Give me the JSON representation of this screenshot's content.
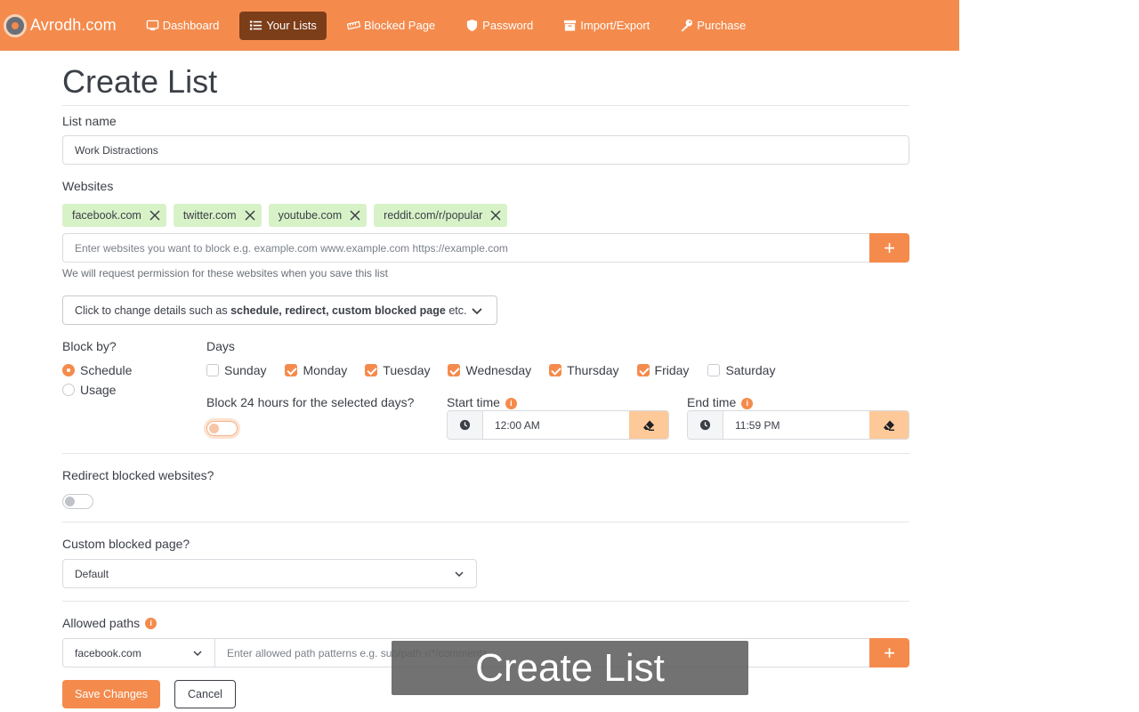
{
  "brand": {
    "name": "Avrodh.com"
  },
  "nav": [
    {
      "label": "Dashboard",
      "icon": "monitor-icon",
      "active": false
    },
    {
      "label": "Your Lists",
      "icon": "list-icon",
      "active": true
    },
    {
      "label": "Blocked Page",
      "icon": "ruler-icon",
      "active": false
    },
    {
      "label": "Password",
      "icon": "shield-icon",
      "active": false
    },
    {
      "label": "Import/Export",
      "icon": "archive-icon",
      "active": false
    },
    {
      "label": "Purchase",
      "icon": "key-icon",
      "active": false
    }
  ],
  "page": {
    "title": "Create List"
  },
  "list_name": {
    "label": "List name",
    "value": "Work Distractions"
  },
  "websites": {
    "label": "Websites",
    "tags": [
      "facebook.com",
      "twitter.com",
      "youtube.com",
      "reddit.com/r/popular"
    ],
    "placeholder": "Enter websites you want to block e.g. example.com www.example.com https://example.com",
    "add_label": "+",
    "help": "We will request permission for these websites when you save this list"
  },
  "details_toggle": {
    "prefix": "Click to change details such as ",
    "bold": "schedule, redirect, custom blocked page",
    "suffix": " etc."
  },
  "block_by": {
    "label": "Block by?",
    "options": [
      {
        "label": "Schedule",
        "checked": true
      },
      {
        "label": "Usage",
        "checked": false
      }
    ]
  },
  "days": {
    "label": "Days",
    "items": [
      {
        "label": "Sunday",
        "checked": false
      },
      {
        "label": "Monday",
        "checked": true
      },
      {
        "label": "Tuesday",
        "checked": true
      },
      {
        "label": "Wednesday",
        "checked": true
      },
      {
        "label": "Thursday",
        "checked": true
      },
      {
        "label": "Friday",
        "checked": true
      },
      {
        "label": "Saturday",
        "checked": false
      }
    ]
  },
  "block_24": {
    "label": "Block 24 hours for the selected days?",
    "on": false
  },
  "start_time": {
    "label": "Start time",
    "value": "12:00 AM"
  },
  "end_time": {
    "label": "End time",
    "value": "11:59 PM"
  },
  "redirect": {
    "label": "Redirect blocked websites?",
    "on": false
  },
  "custom_page": {
    "label": "Custom blocked page?",
    "value": "Default"
  },
  "allowed_paths": {
    "label": "Allowed paths",
    "site": "facebook.com",
    "placeholder": "Enter allowed path patterns e.g. sub/path r/*/comments",
    "add_label": "+"
  },
  "actions": {
    "save": "Save Changes",
    "cancel": "Cancel"
  },
  "toast": {
    "text": "Create List"
  },
  "colors": {
    "accent": "#f48b4d",
    "nav_active": "#7c3d19",
    "tag_bg": "#d8f2c8"
  }
}
